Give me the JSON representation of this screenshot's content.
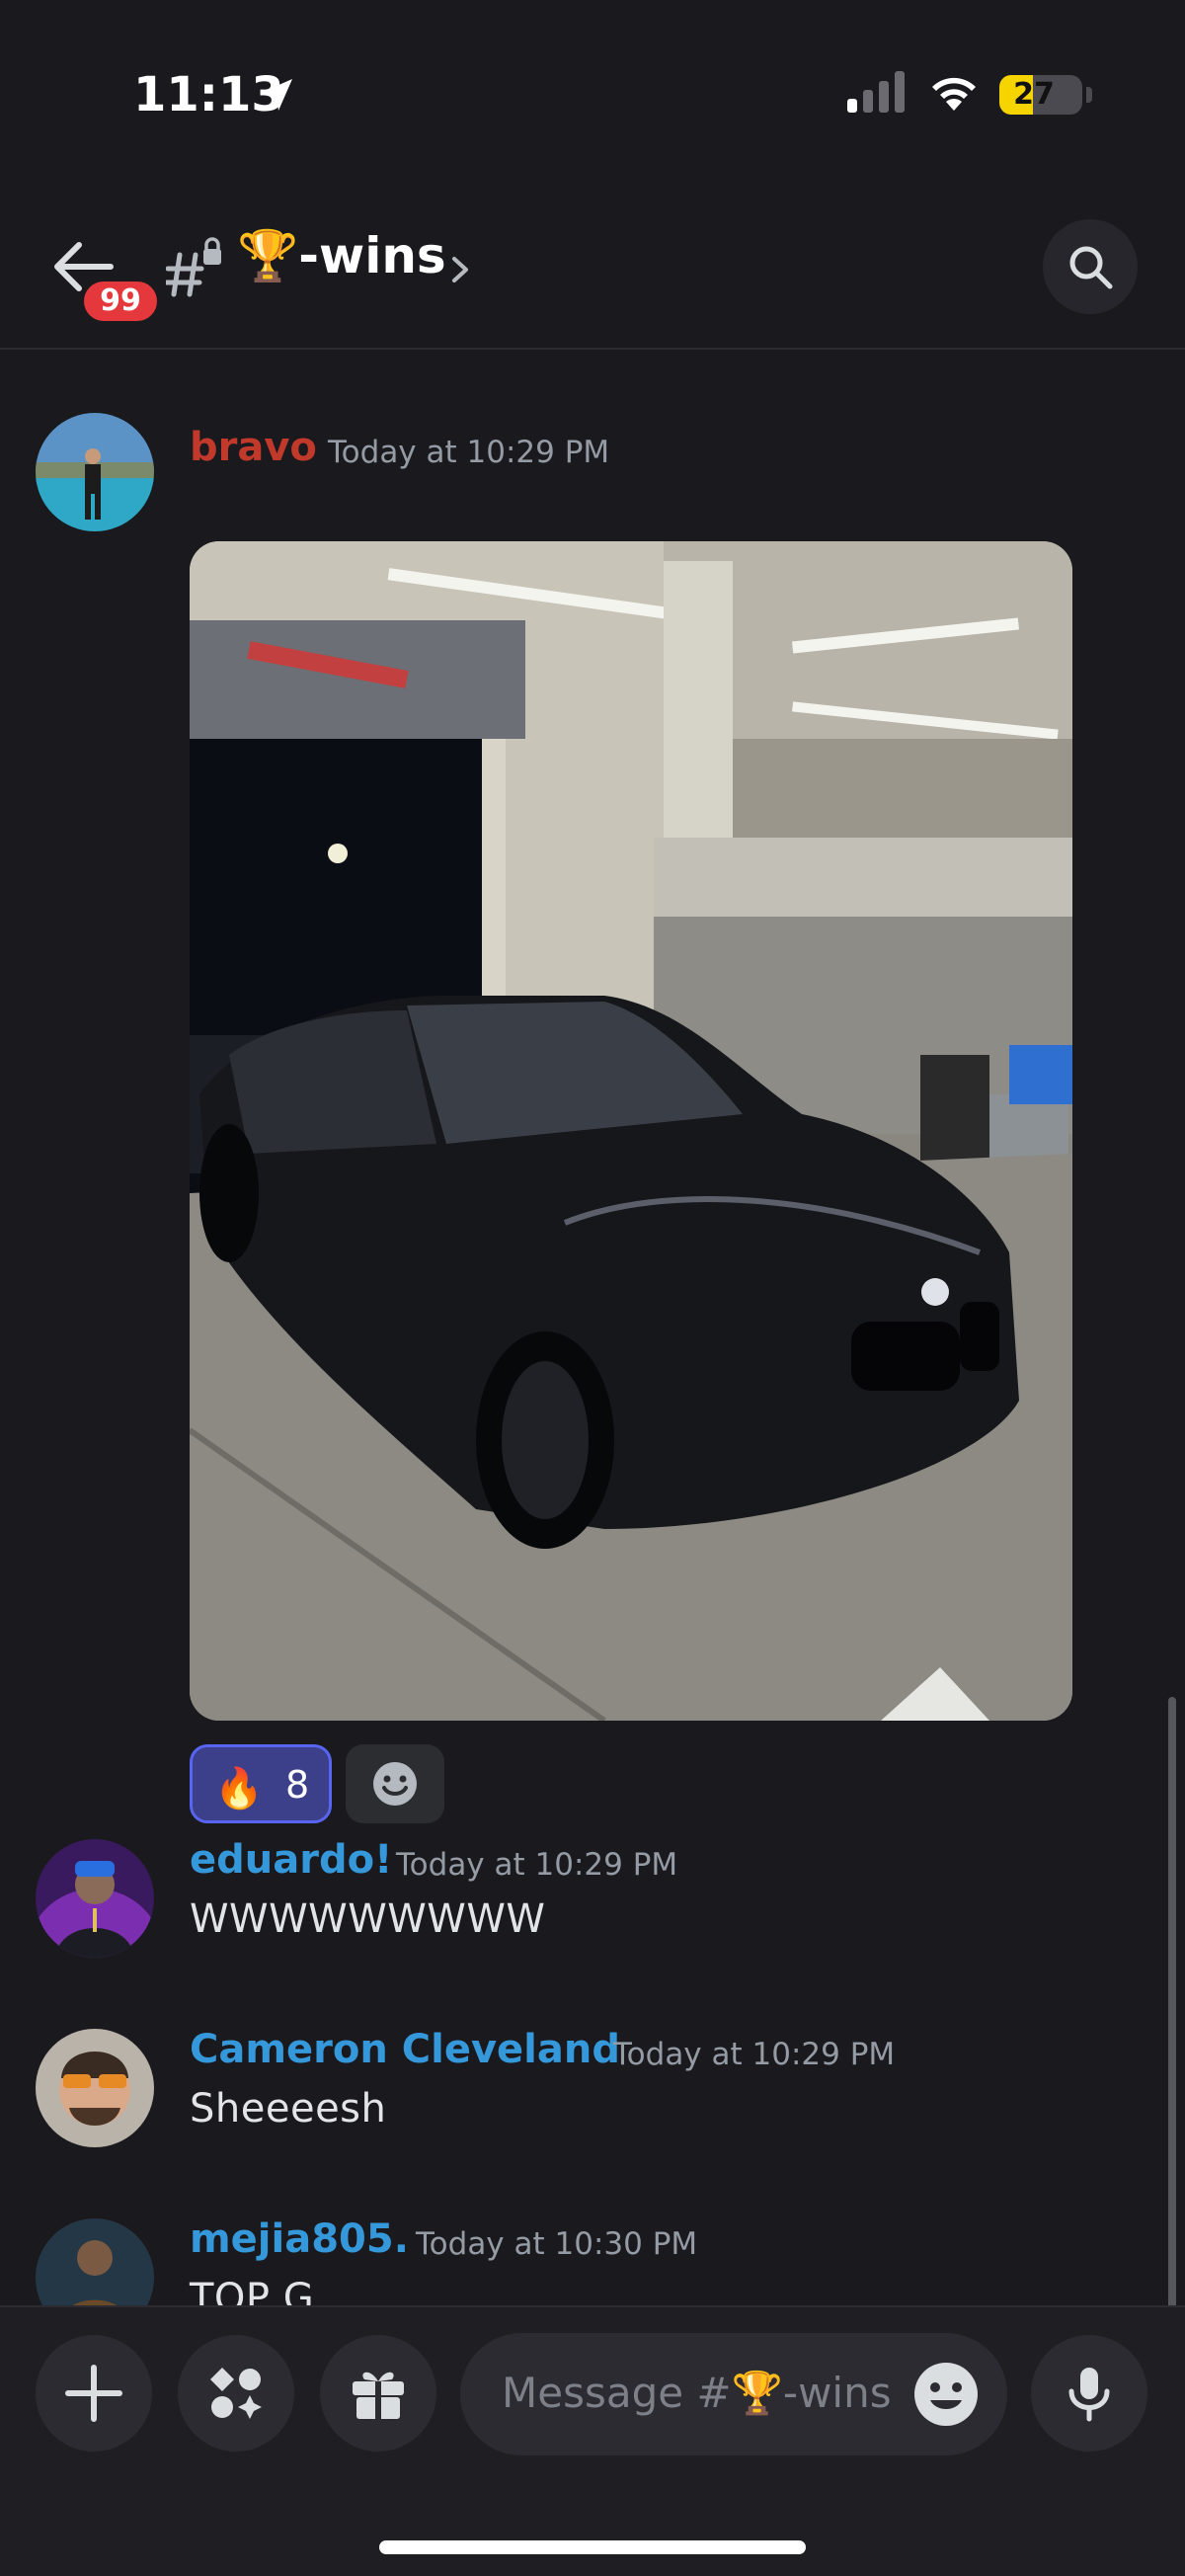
{
  "status_bar": {
    "time": "11:13",
    "battery": "27",
    "battery_color": "#f5d400"
  },
  "header": {
    "unread_badge": "99",
    "channel_name": "🏆-wins",
    "icons": [
      "back-arrow-icon",
      "locked-hash-icon",
      "chevron-right-icon",
      "search-icon"
    ]
  },
  "messages": [
    {
      "author": "bravo",
      "author_color": "#c0392b",
      "timestamp": "Today at 10:29 PM",
      "has_image": true,
      "reactions": [
        {
          "emoji": "🔥",
          "count": "8"
        }
      ]
    },
    {
      "author": "eduardo!",
      "author_color": "#3498db",
      "timestamp": "Today at 10:29 PM",
      "text": "WWWWWWWWW"
    },
    {
      "author": "Cameron Cleveland",
      "author_color": "#3498db",
      "timestamp": "Today at 10:29 PM",
      "text": "Sheeeesh"
    },
    {
      "author": "mejia805.",
      "author_color": "#3498db",
      "timestamp": "Today at 10:30 PM",
      "text": "TOP G"
    }
  ],
  "composer": {
    "placeholder": "Message #🏆-wins",
    "icons": [
      "plus-icon",
      "apps-icon",
      "gift-icon",
      "emoji-icon",
      "microphone-icon"
    ]
  },
  "colors": {
    "background": "#1a1a1e",
    "accent": "#5865f2",
    "badge": "#e5383d",
    "link_name": "#3498db"
  }
}
